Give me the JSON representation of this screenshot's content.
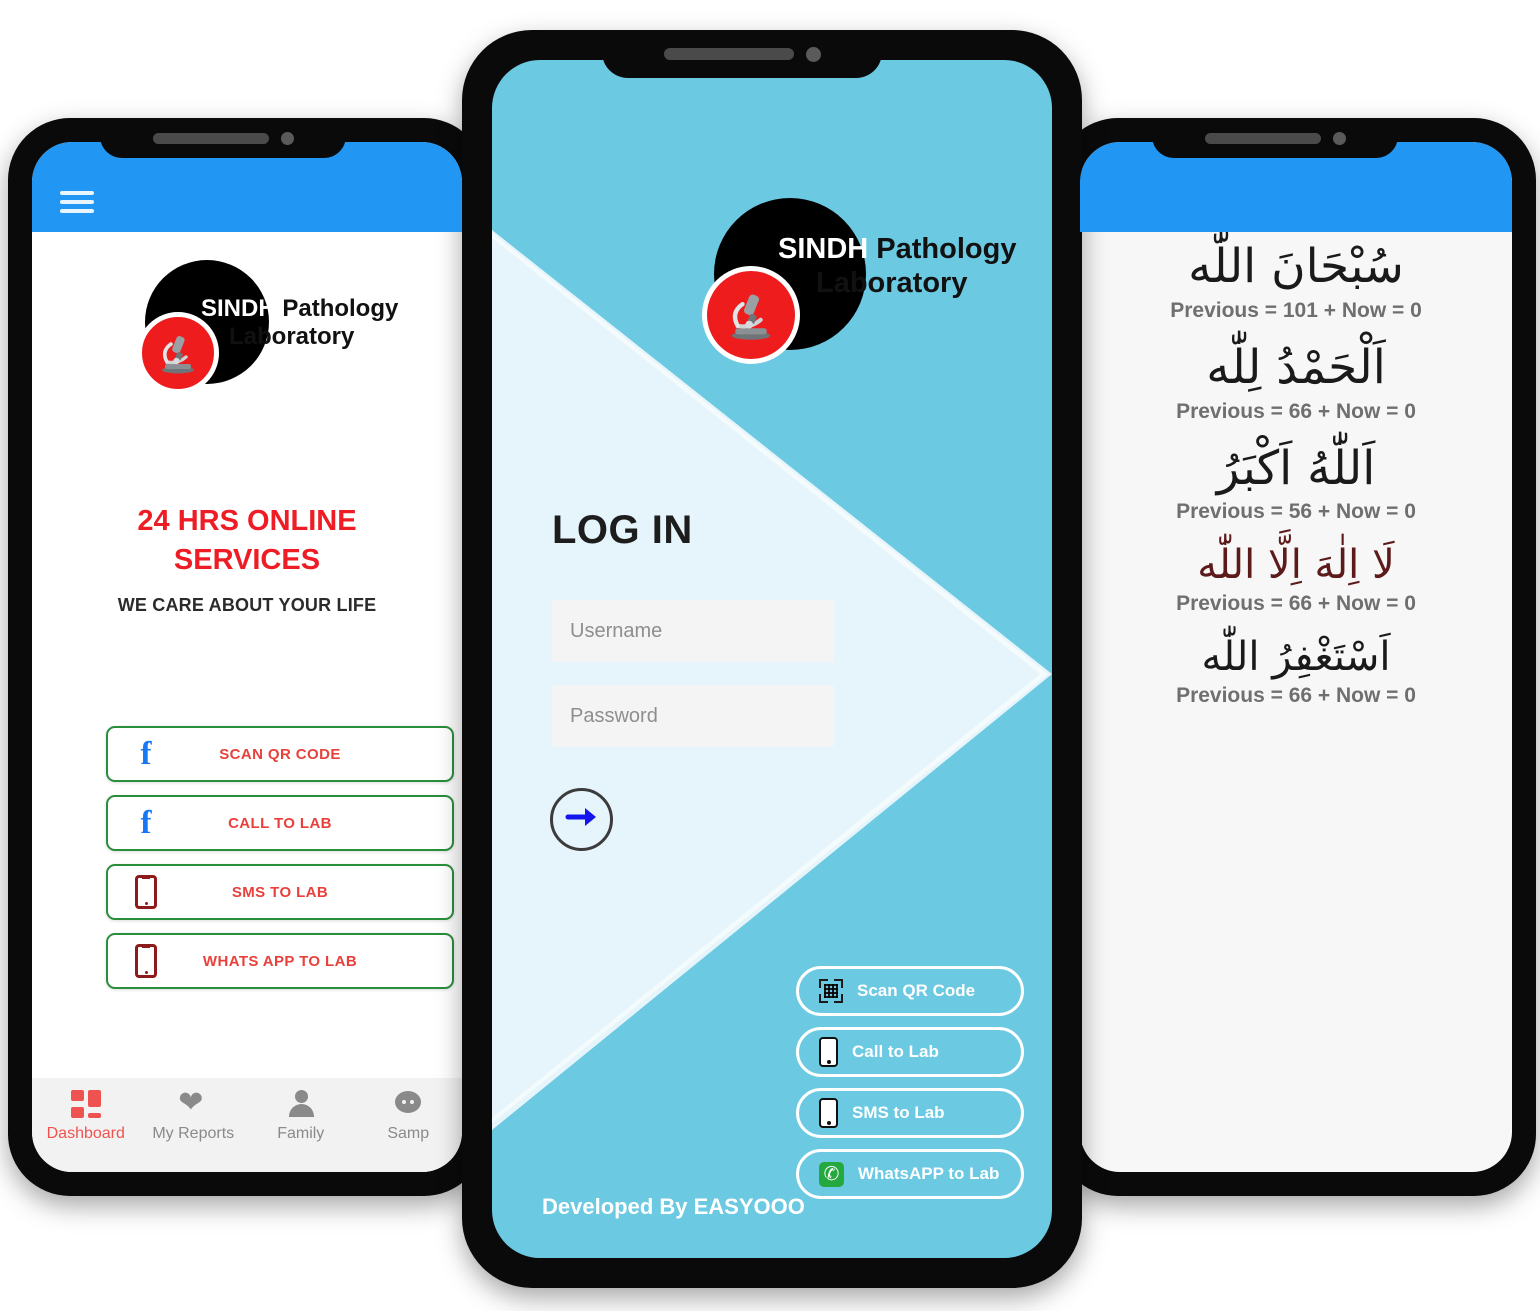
{
  "brand": {
    "logo_line1_bold": "SINDH",
    "logo_line1_rest": " Pathology",
    "logo_line2": "Laboratory",
    "accent_blue": "#2196f3",
    "accent_teal": "#6bc9e2",
    "accent_red": "#ee1c24",
    "accent_green": "#2a8f3c"
  },
  "left_phone": {
    "menu_icon": "hamburger-icon",
    "headline": "24 HRS ONLINE SERVICES",
    "headline_line1": "24 HRS ONLINE",
    "headline_line2": "SERVICES",
    "tagline": "WE CARE ABOUT YOUR LIFE",
    "buttons": [
      {
        "label": "SCAN QR CODE",
        "icon": "facebook-icon"
      },
      {
        "label": "CALL TO LAB",
        "icon": "facebook-icon"
      },
      {
        "label": "SMS TO LAB",
        "icon": "mobile-phone-icon"
      },
      {
        "label": "WHATS APP TO LAB",
        "icon": "mobile-phone-icon"
      }
    ],
    "bottom_nav": [
      {
        "label": "Dashboard",
        "icon": "dashboard-grid-icon",
        "active": true
      },
      {
        "label": "My Reports",
        "icon": "heart-icon",
        "active": false
      },
      {
        "label": "Family",
        "icon": "person-icon",
        "active": false
      },
      {
        "label": "Samp",
        "icon": "chat-bubble-icon",
        "active": false
      }
    ]
  },
  "center_phone": {
    "login_title": "LOG IN",
    "username_placeholder": "Username",
    "password_placeholder": "Password",
    "submit_icon": "arrow-right-circle-icon",
    "footer": "Developed By EASYOOO",
    "buttons": [
      {
        "label": "Scan QR Code",
        "icon": "qr-code-icon"
      },
      {
        "label": "Call to Lab",
        "icon": "mobile-phone-icon"
      },
      {
        "label": "SMS to Lab",
        "icon": "mobile-phone-icon"
      },
      {
        "label": "WhatsAPP to Lab",
        "icon": "whatsapp-icon"
      }
    ]
  },
  "right_phone": {
    "zikr_items": [
      {
        "arabic": "سُبْحَانَ اللّٰه",
        "count_text": "Previous = 101  +  Now = 0",
        "previous": 101,
        "now": 0
      },
      {
        "arabic": "اَلْحَمْدُ لِلّٰه",
        "count_text": "Previous = 66  +  Now = 0",
        "previous": 66,
        "now": 0
      },
      {
        "arabic": "اَللّٰهُ اَكْبَرُ",
        "count_text": "Previous = 56  +  Now = 0",
        "previous": 56,
        "now": 0
      },
      {
        "arabic": "لَا اِلٰهَ اِلَّا اللّٰه",
        "count_text": "Previous = 66  +  Now = 0",
        "previous": 66,
        "now": 0
      },
      {
        "arabic": "اَسْتَغْفِرُ اللّٰه",
        "count_text": "Previous = 66  +  Now = 0",
        "previous": 66,
        "now": 0
      }
    ]
  }
}
